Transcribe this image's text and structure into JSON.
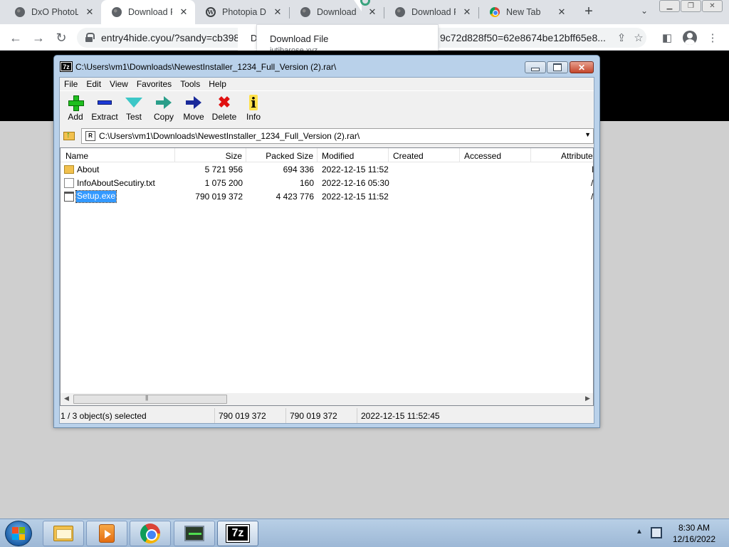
{
  "browser": {
    "tabs": [
      {
        "title": "DxO PhotoLa",
        "icon": "globe-icon",
        "active": false
      },
      {
        "title": "Download Fi",
        "icon": "globe-icon",
        "active": true
      },
      {
        "title": "Photopia Dir",
        "icon": "wordpress-icon",
        "active": false
      },
      {
        "title": "Download",
        "icon": "globe-icon",
        "active": false
      },
      {
        "title": "Download Fi",
        "icon": "globe-icon",
        "active": false
      },
      {
        "title": "New Tab",
        "icon": "chrome-icon",
        "active": false
      }
    ],
    "close_glyph": "✕",
    "new_tab_glyph": "+",
    "url_left": "entry4hide.cyou/?sandy=cb398",
    "url_right": "9c72d828f50=62e8674be12bff65e8...",
    "tooltip": {
      "title": "Download File",
      "url": "jutibarose.xyz"
    },
    "hidden_tab_letter": "D"
  },
  "sevenzip": {
    "title": "C:\\Users\\vm1\\Downloads\\NewestInstaller_1234_Full_Version (2).rar\\",
    "app_icon_text": "7z",
    "menu": [
      "File",
      "Edit",
      "View",
      "Favorites",
      "Tools",
      "Help"
    ],
    "toolbar": [
      {
        "label": "Add",
        "icon": "add-icon"
      },
      {
        "label": "Extract",
        "icon": "extract-icon"
      },
      {
        "label": "Test",
        "icon": "test-icon"
      },
      {
        "label": "Copy",
        "icon": "copy-icon"
      },
      {
        "label": "Move",
        "icon": "move-icon"
      },
      {
        "label": "Delete",
        "icon": "delete-icon"
      },
      {
        "label": "Info",
        "icon": "info-icon"
      }
    ],
    "address": "C:\\Users\\vm1\\Downloads\\NewestInstaller_1234_Full_Version (2).rar\\",
    "address_icon_text": "R",
    "columns": [
      "Name",
      "Size",
      "Packed Size",
      "Modified",
      "Created",
      "Accessed",
      "Attribute"
    ],
    "rows": [
      {
        "name": "About",
        "type": "folder",
        "size": "5 721 956",
        "packed": "694 336",
        "modified": "2022-12-15 11:52",
        "created": "",
        "accessed": "",
        "attr": "I",
        "selected": false
      },
      {
        "name": "InfoAboutSecutiry.txt",
        "type": "txt",
        "size": "1 075 200",
        "packed": "160",
        "modified": "2022-12-16 05:30",
        "created": "",
        "accessed": "",
        "attr": "/",
        "selected": false
      },
      {
        "name": "Setup.exe",
        "type": "exe",
        "size": "790 019 372",
        "packed": "4 423 776",
        "modified": "2022-12-15 11:52",
        "created": "",
        "accessed": "",
        "attr": "/",
        "selected": true
      }
    ],
    "status": {
      "selection": "1 / 3 object(s) selected",
      "size": "790 019 372",
      "packed": "790 019 372",
      "modified": "2022-12-15 11:52:45"
    }
  },
  "taskbar": {
    "apps": [
      "explorer",
      "media-player",
      "chrome",
      "network-monitor",
      "7-zip"
    ],
    "sevenzip_icon_text": "7z",
    "time": "8:30 AM",
    "date": "12/16/2022"
  }
}
